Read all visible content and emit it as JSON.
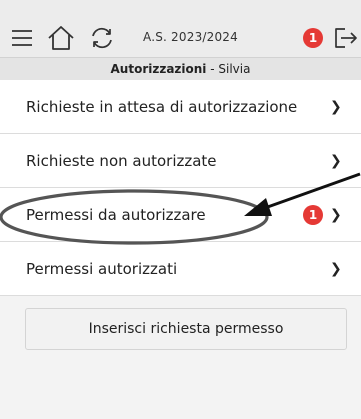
{
  "toolbar": {
    "school_year": "A.S. 2023/2024",
    "notification_count": "1"
  },
  "subheader": {
    "section": "Autorizzazioni",
    "separator": " - ",
    "user": "Silvia"
  },
  "list": {
    "items": [
      {
        "label": "Richieste in attesa di autorizzazione",
        "chevron": "❯"
      },
      {
        "label": "Richieste non autorizzate",
        "chevron": "❯"
      },
      {
        "label": "Permessi da autorizzare",
        "badge": "1",
        "chevron": "❯"
      },
      {
        "label": "Permessi autorizzati",
        "chevron": "❯"
      }
    ]
  },
  "actions": {
    "add_request_label": "Inserisci richiesta permesso"
  },
  "colors": {
    "badge": "#e53935",
    "toolbar_bg": "#ececec",
    "annotation": "#555555"
  },
  "icons": [
    "hamburger-menu-icon",
    "home-icon",
    "refresh-icon",
    "logout-icon",
    "chevron-right-icon"
  ]
}
